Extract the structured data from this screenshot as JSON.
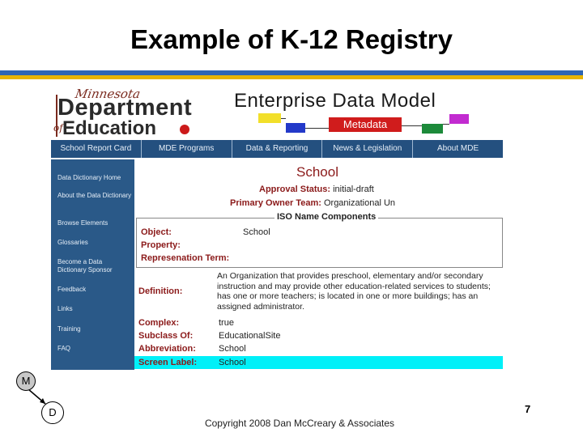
{
  "slide": {
    "title": "Example of K-12 Registry",
    "copyright": "Copyright 2008 Dan McCreary & Associates",
    "page_number": "7",
    "badges": {
      "m": "M",
      "d": "D"
    }
  },
  "banner": {
    "logo_script": "Minnesota",
    "logo_department": "Department",
    "logo_of": "of",
    "logo_education": "Education",
    "edm_title": "Enterprise Data Model",
    "metadata_label": "Metadata"
  },
  "nav": {
    "items": [
      {
        "label": "School Report Card"
      },
      {
        "label": "MDE Programs"
      },
      {
        "label": "Data & Reporting"
      },
      {
        "label": "News & Legislation"
      },
      {
        "label": "About MDE"
      }
    ]
  },
  "sidebar": {
    "items": [
      {
        "label": "Data Dictionary Home"
      },
      {
        "label": "About the Data Dictionary"
      },
      {
        "label": "Browse Elements"
      },
      {
        "label": "Glossaries"
      },
      {
        "label": "Become a Data Dictionary Sponsor"
      },
      {
        "label": "Feedback"
      },
      {
        "label": "Links"
      },
      {
        "label": "Training"
      },
      {
        "label": "FAQ"
      }
    ]
  },
  "element": {
    "name": "School",
    "approval_status_label": "Approval Status:",
    "approval_status_value": "initial-draft",
    "owner_label": "Primary Owner Team:",
    "owner_value": "Organizational Un",
    "iso_title": "ISO Name Components",
    "object_label": "Object:",
    "object_value": "School",
    "property_label": "Property:",
    "property_value": "",
    "representation_label": "Represenation Term:",
    "representation_value": "",
    "definition_label": "Definition:",
    "definition_value": "An Organization that provides preschool, elementary and/or secondary instruction and may provide other education-related services to students; has one or more teachers; is located in one or more buildings; has an assigned administrator.",
    "complex_label": "Complex:",
    "complex_value": "true",
    "subclass_label": "Subclass Of:",
    "subclass_value": "EducationalSite",
    "abbreviation_label": "Abbreviation:",
    "abbreviation_value": "School",
    "screen_label_label": "Screen Label:",
    "screen_label_value": "School"
  },
  "colors": {
    "accent_blue": "#2e66b3",
    "accent_gold": "#e8b400",
    "nav_bg": "#24507f",
    "label_red": "#8b1a1a",
    "highlight_cyan": "#00f0f8"
  }
}
